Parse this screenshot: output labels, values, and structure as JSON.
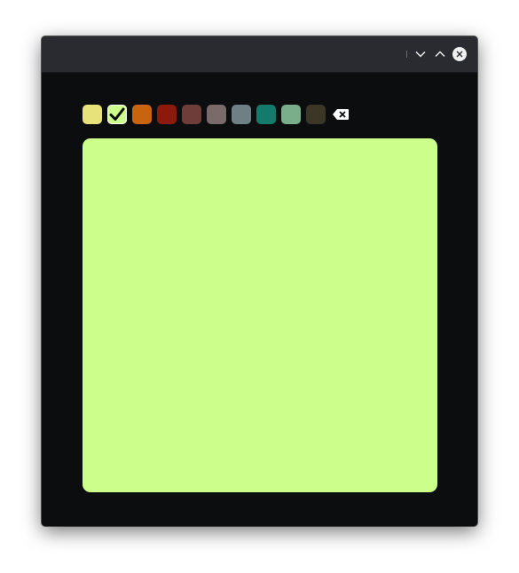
{
  "titlebar": {
    "minimize_icon": "chevron-down-icon",
    "maximize_icon": "chevron-up-icon",
    "close_icon": "close-icon"
  },
  "palette": {
    "selected_index": 1,
    "colors": [
      {
        "name": "yellow",
        "hex": "#e8e27a"
      },
      {
        "name": "lime",
        "hex": "#ccfe8c"
      },
      {
        "name": "orange",
        "hex": "#c9640e"
      },
      {
        "name": "red",
        "hex": "#8b1a0d"
      },
      {
        "name": "brown",
        "hex": "#6e3d3a"
      },
      {
        "name": "taupe",
        "hex": "#7a6a6a"
      },
      {
        "name": "slate",
        "hex": "#6e8084"
      },
      {
        "name": "teal",
        "hex": "#147a6b"
      },
      {
        "name": "sage",
        "hex": "#7aae8a"
      },
      {
        "name": "olive-dark",
        "hex": "#3b3626"
      }
    ],
    "clear_icon": "backspace-icon"
  },
  "note": {
    "text": "",
    "background": "#ccfe8c"
  }
}
